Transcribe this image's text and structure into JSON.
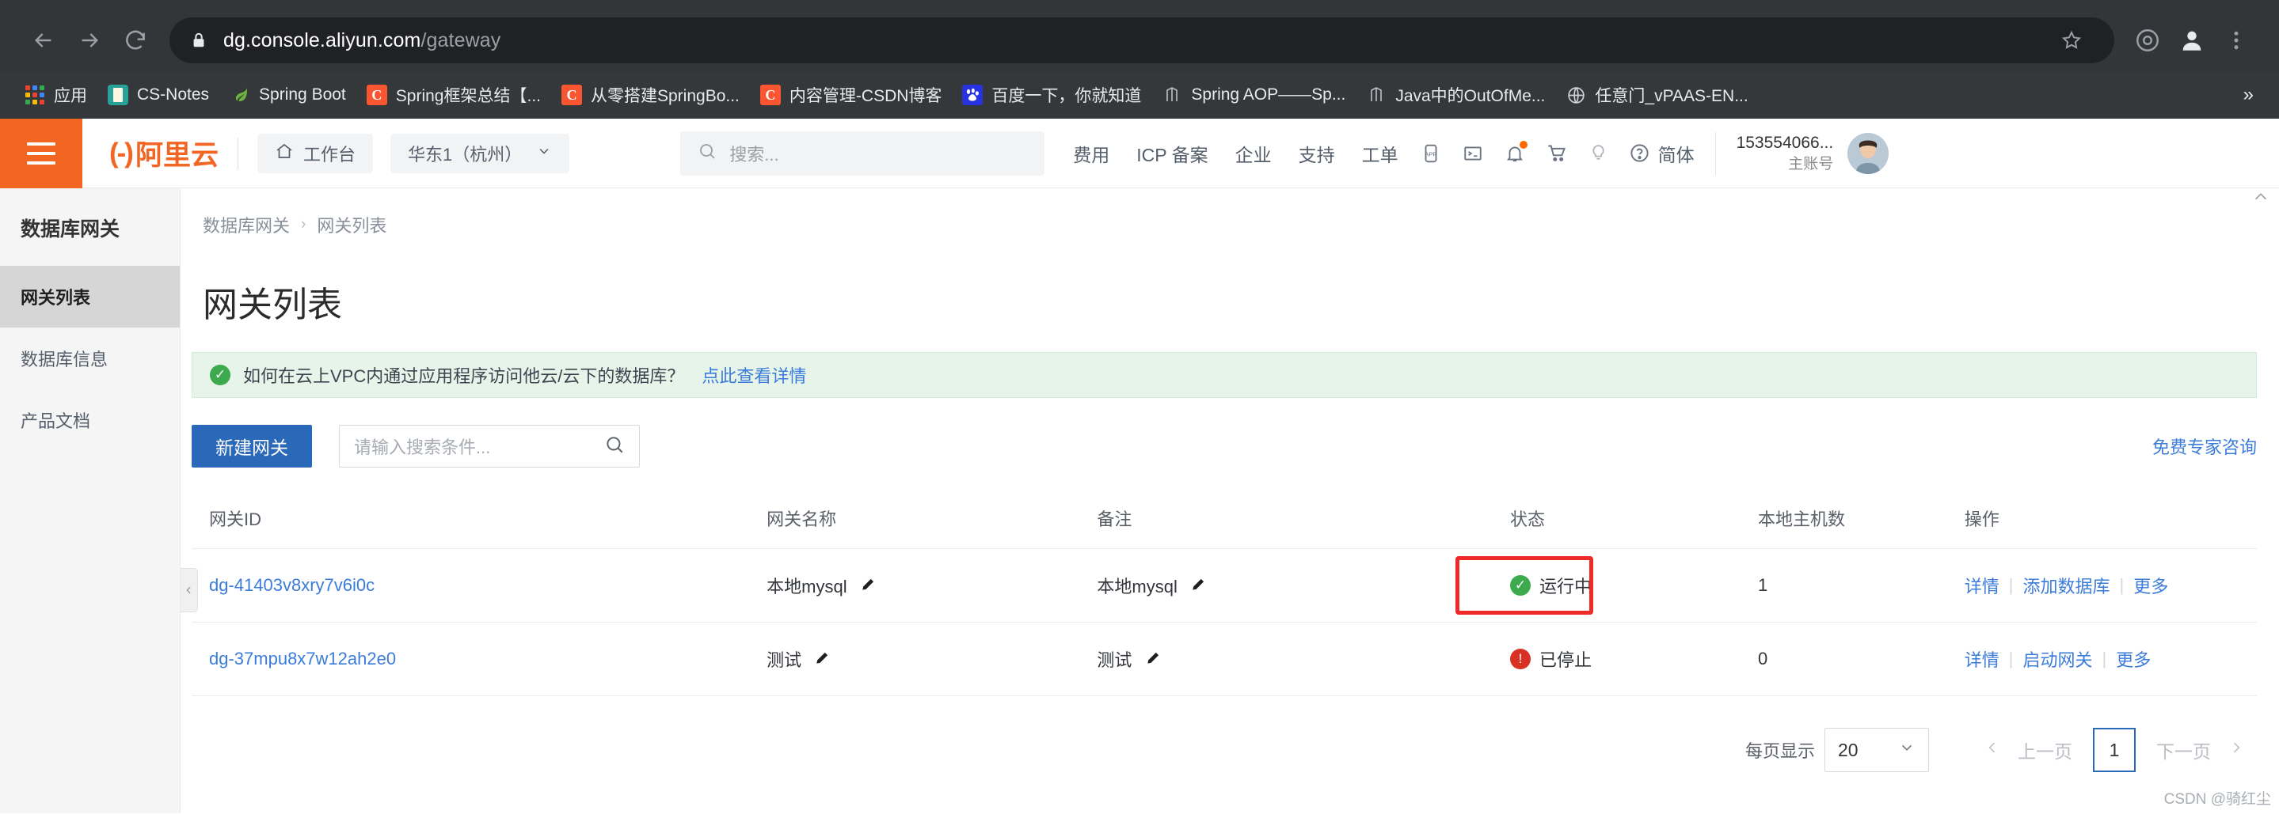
{
  "browser": {
    "back_icon": "back-arrow-icon",
    "forward_icon": "forward-arrow-icon",
    "reload_icon": "reload-icon",
    "lock_icon": "lock-icon",
    "url_host": "dg.console.aliyun.com",
    "url_path": "/gateway",
    "star_icon": "bookmark-star-icon",
    "extensions_icon": "extensions-icon",
    "profile_icon": "profile-avatar-icon",
    "menu_icon": "browser-menu-icon",
    "bookmarks": [
      {
        "label": "应用",
        "icon": "apps-grid-icon"
      },
      {
        "label": "CS-Notes",
        "icon": "book-icon"
      },
      {
        "label": "Spring Boot",
        "icon": "spring-leaf-icon"
      },
      {
        "label": "Spring框架总结【...",
        "icon": "csdn-icon"
      },
      {
        "label": "从零搭建SpringBo...",
        "icon": "csdn-icon"
      },
      {
        "label": "内容管理-CSDN博客",
        "icon": "csdn-icon"
      },
      {
        "label": "百度一下，你就知道",
        "icon": "baidu-icon"
      },
      {
        "label": "Spring AOP——Sp...",
        "icon": "jianshu-icon"
      },
      {
        "label": "Java中的OutOfMe...",
        "icon": "jianshu-icon"
      },
      {
        "label": "任意门_vPAAS-EN...",
        "icon": "globe-icon"
      }
    ],
    "bookmarks_overflow": "»"
  },
  "console_header": {
    "menu_icon": "hamburger-menu-icon",
    "logo_text": "阿里云",
    "workbench_label": "工作台",
    "workbench_icon": "home-icon",
    "region_label": "华东1（杭州）",
    "region_caret": "chevron-down-icon",
    "search_placeholder": "搜索...",
    "search_icon": "search-icon",
    "nav": [
      {
        "label": "费用"
      },
      {
        "label": "ICP 备案"
      },
      {
        "label": "企业"
      },
      {
        "label": "支持"
      },
      {
        "label": "工单"
      }
    ],
    "icons": [
      {
        "name": "app-mobile-icon"
      },
      {
        "name": "terminal-icon"
      },
      {
        "name": "bell-notification-icon"
      },
      {
        "name": "shopping-cart-icon"
      },
      {
        "name": "lightbulb-icon"
      },
      {
        "name": "help-question-icon"
      }
    ],
    "language_label": "简体",
    "account_id": "153554066...",
    "account_type": "主账号",
    "avatar_icon": "user-avatar"
  },
  "sidebar": {
    "title": "数据库网关",
    "items": [
      {
        "label": "网关列表",
        "active": true
      },
      {
        "label": "数据库信息",
        "active": false
      },
      {
        "label": "产品文档",
        "active": false
      }
    ],
    "collapse_icon": "chevron-left-icon"
  },
  "main": {
    "breadcrumb": [
      {
        "label": "数据库网关"
      },
      {
        "label": "网关列表"
      }
    ],
    "breadcrumb_separator": "›",
    "page_title": "网关列表",
    "notice": {
      "icon": "check-circle-icon",
      "text": "如何在云上VPC内通过应用程序访问他云/云下的数据库？",
      "link_label": "点此查看详情",
      "bg_color": "#e7f4e9",
      "icon_color": "#3caa4d",
      "link_color": "#3b7cdb"
    },
    "toolbar": {
      "create_button_label": "新建网关",
      "create_button_color": "#2a68b9",
      "search_placeholder": "请输入搜索条件...",
      "search_icon": "search-icon",
      "expert_link_label": "免费专家咨询"
    },
    "table": {
      "columns": [
        "网关ID",
        "网关名称",
        "备注",
        "状态",
        "本地主机数",
        "操作"
      ],
      "rows": [
        {
          "id": "dg-41403v8xry7v6i0c",
          "name": "本地mysql",
          "name_edit_icon": "pencil-edit-icon",
          "note": "本地mysql",
          "note_edit_icon": "pencil-edit-icon",
          "status": "运行中",
          "status_type": "running",
          "status_icon": "check-circle-icon",
          "status_color": "#3caa4d",
          "hosts": "1",
          "operations": [
            "详情",
            "添加数据库",
            "更多"
          ],
          "highlighted": true
        },
        {
          "id": "dg-37mpu8x7w12ah2e0",
          "name": "测试",
          "name_edit_icon": "pencil-edit-icon",
          "note": "测试",
          "note_edit_icon": "pencil-edit-icon",
          "status": "已停止",
          "status_type": "stopped",
          "status_icon": "exclamation-circle-icon",
          "status_color": "#d93026",
          "hosts": "0",
          "operations": [
            "详情",
            "启动网关",
            "更多"
          ],
          "highlighted": false
        }
      ]
    },
    "pagination": {
      "page_size_label": "每页显示",
      "page_size_value": "20",
      "page_size_caret": "chevron-down-icon",
      "prev_arrow_icon": "chevron-left-icon",
      "prev_label": "上一页",
      "current_page": "1",
      "next_label": "下一页",
      "next_arrow_icon": "chevron-right-icon"
    },
    "watermark": "CSDN @骑红尘",
    "highlight_color": "#ee2b26"
  }
}
